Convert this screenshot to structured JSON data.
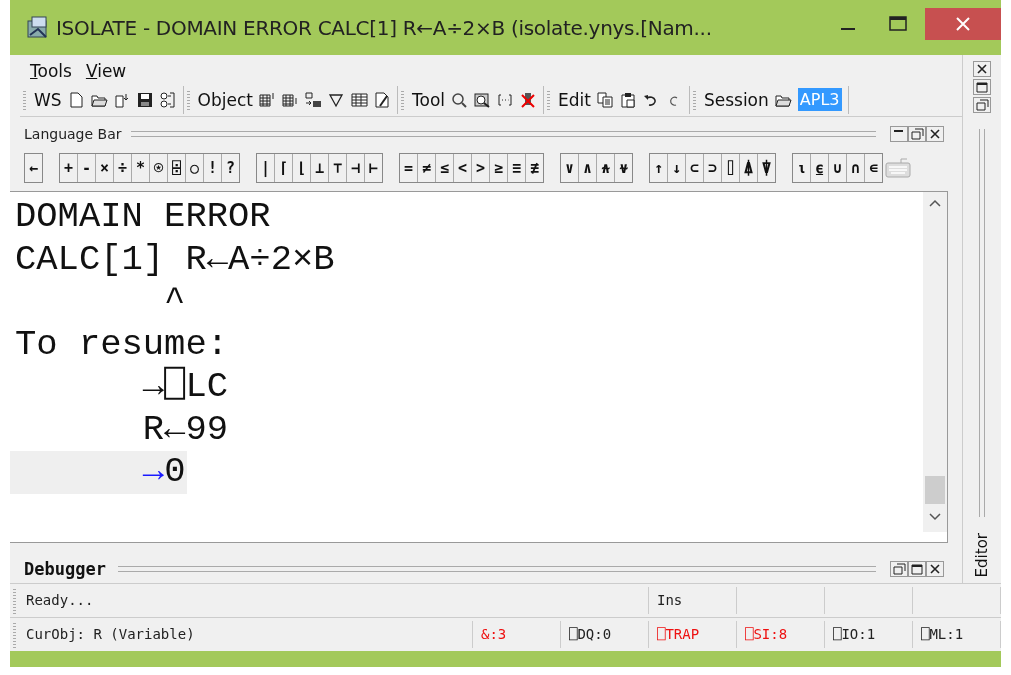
{
  "window": {
    "title": "ISOLATE -  DOMAIN ERROR  CALC[1] R←A÷2×B  (isolate.ynys.[Nam..."
  },
  "menu": [
    {
      "label": "Tools"
    },
    {
      "label": "View"
    }
  ],
  "toolbar": [
    {
      "label": "WS",
      "kind": "ws"
    },
    {
      "label": "Object",
      "kind": "object"
    },
    {
      "label": "Tool",
      "kind": "tool"
    },
    {
      "label": "Edit",
      "kind": "edit"
    },
    {
      "label": "Session",
      "kind": "session",
      "field": "APL3"
    }
  ],
  "language_bar": {
    "title": "Language Bar",
    "groups": [
      [
        "←"
      ],
      [
        "+",
        "-",
        "×",
        "÷",
        "*",
        "⍟",
        "⌹",
        "○",
        "!",
        "?"
      ],
      [
        "|",
        "⌈",
        "⌊",
        "⊥",
        "⊤",
        "⊣",
        "⊢"
      ],
      [
        "=",
        "≠",
        "≤",
        "<",
        ">",
        "≥",
        "≡",
        "≢"
      ],
      [
        "∨",
        "∧",
        "⍲",
        "⍱"
      ],
      [
        "↑",
        "↓",
        "⊂",
        "⊃",
        "⌷",
        "⍋",
        "⍒"
      ],
      [
        "⍳",
        "⍷",
        "∪",
        "∩",
        "∊"
      ]
    ]
  },
  "session": {
    "lines": [
      {
        "parts": [
          {
            "text": "DOMAIN ERROR",
            "kind": "plain"
          }
        ],
        "current": false
      },
      {
        "parts": [
          {
            "text": "CALC[1] R←A÷2×B",
            "kind": "plain"
          }
        ],
        "current": false
      },
      {
        "parts": [
          {
            "text": "       ^",
            "kind": "plain"
          }
        ],
        "current": false
      },
      {
        "parts": [
          {
            "text": "To resume:",
            "kind": "plain"
          }
        ],
        "current": false
      },
      {
        "parts": [
          {
            "text": "→⎕LC",
            "kind": "plain"
          }
        ],
        "current": false,
        "indented": true
      },
      {
        "parts": [
          {
            "text": "R←99",
            "kind": "plain"
          }
        ],
        "current": false,
        "indented": true
      },
      {
        "parts": [
          {
            "text": "→",
            "kind": "primitive"
          },
          {
            "text": "0",
            "kind": "plain"
          }
        ],
        "current": true,
        "indented": true
      }
    ]
  },
  "side_panel": {
    "label": "Editor"
  },
  "debugger": {
    "title": "Debugger"
  },
  "status_bar": [
    {
      "text": "Ready...",
      "kind": "wide"
    },
    {
      "text": "Ins",
      "kind": "cell"
    },
    {
      "kind": "blank"
    },
    {
      "kind": "blank"
    },
    {
      "kind": "blank"
    }
  ],
  "info_bar": [
    {
      "text": "CurObj: R (Variable)",
      "alert": false,
      "kind": "wide"
    },
    {
      "text": "&:3",
      "alert": true,
      "kind": "cell"
    },
    {
      "text": "⎕DQ:0",
      "alert": false,
      "kind": "cell"
    },
    {
      "text": "⎕TRAP",
      "alert": true,
      "kind": "cell"
    },
    {
      "text": "⎕SI:8",
      "alert": true,
      "kind": "cell"
    },
    {
      "text": "⎕IO:1",
      "alert": false,
      "kind": "cell"
    },
    {
      "text": "⎕ML:1",
      "alert": false,
      "kind": "cell"
    }
  ]
}
